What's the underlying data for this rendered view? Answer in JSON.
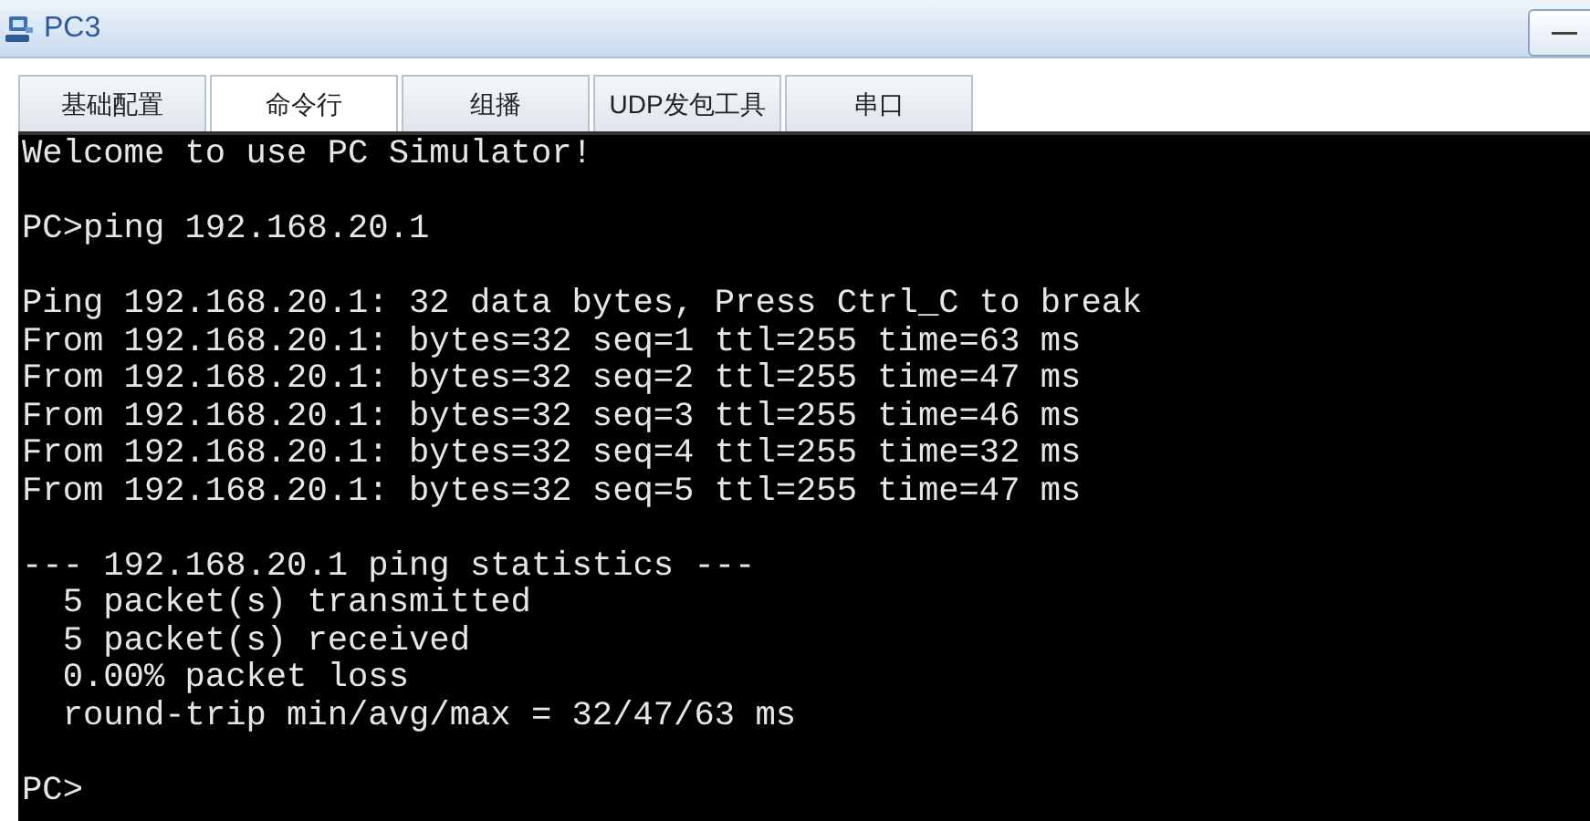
{
  "window": {
    "title": "PC3",
    "minimize": "—"
  },
  "tabs": [
    {
      "label": "基础配置",
      "selected": false
    },
    {
      "label": "命令行",
      "selected": true
    },
    {
      "label": "组播",
      "selected": false
    },
    {
      "label": "UDP发包工具",
      "selected": false
    },
    {
      "label": "串口",
      "selected": false
    }
  ],
  "terminal": {
    "blocks": [
      [
        "Welcome to use PC Simulator!"
      ],
      [
        "PC>ping 192.168.20.1"
      ],
      [
        "Ping 192.168.20.1: 32 data bytes, Press Ctrl_C to break",
        "From 192.168.20.1: bytes=32 seq=1 ttl=255 time=63 ms",
        "From 192.168.20.1: bytes=32 seq=2 ttl=255 time=47 ms",
        "From 192.168.20.1: bytes=32 seq=3 ttl=255 time=46 ms",
        "From 192.168.20.1: bytes=32 seq=4 ttl=255 time=32 ms",
        "From 192.168.20.1: bytes=32 seq=5 ttl=255 time=47 ms"
      ],
      [
        "--- 192.168.20.1 ping statistics ---",
        "  5 packet(s) transmitted",
        "  5 packet(s) received",
        "  0.00% packet loss",
        "  round-trip min/avg/max = 32/47/63 ms"
      ],
      [
        "PC>"
      ]
    ]
  }
}
